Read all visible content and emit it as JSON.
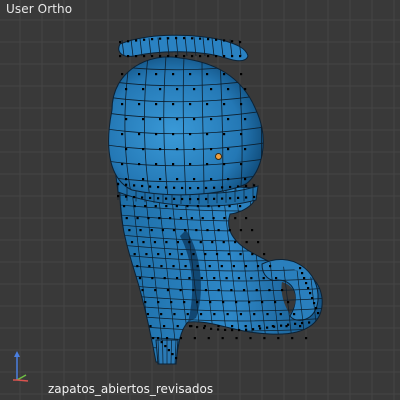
{
  "viewport": {
    "view_name": "User Ortho",
    "object_name": "zapatos_abiertos_revisados",
    "background_color": "#393939",
    "grid_color": "#454545"
  },
  "model": {
    "subject": "high-heel open sandal mesh (edit mode)",
    "face_color": "#2e86c8",
    "dark_color": "#0a3558",
    "wire_color": "#0d1f2e",
    "vertex_color": "#000000"
  },
  "pivot": {
    "color": "#f0a040"
  },
  "axes": {
    "x_color": "#d9534f",
    "y_color": "#6fbf45",
    "z_color": "#4a7fe0"
  }
}
